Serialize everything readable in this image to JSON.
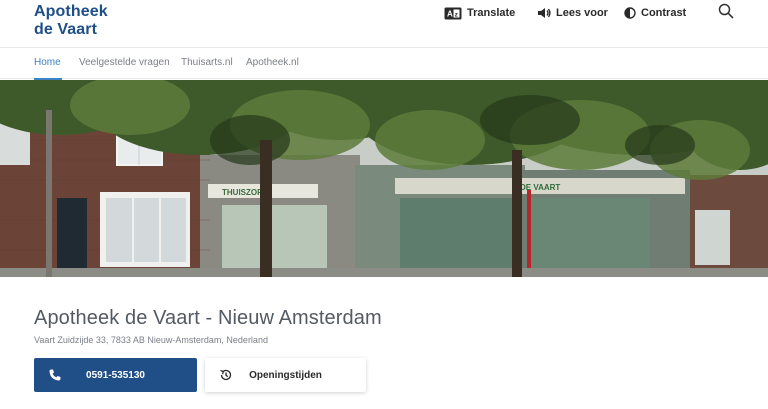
{
  "brand": {
    "line1": "Apotheek",
    "line2": "de Vaart"
  },
  "toolbar": {
    "translate_label": "Translate",
    "translate_icon": "translate-icon",
    "read_label": "Lees voor",
    "read_icon": "speaker-icon",
    "contrast_label": "Contrast",
    "contrast_icon": "contrast-icon",
    "search_icon": "search-icon"
  },
  "nav": {
    "items": [
      {
        "label": "Home",
        "active": true
      },
      {
        "label": "Veelgestelde vragen",
        "active": false
      },
      {
        "label": "Thuisarts.nl",
        "active": false
      },
      {
        "label": "Apotheek.nl",
        "active": false
      }
    ]
  },
  "hero": {
    "description_image": "pharmacy-storefront-photo"
  },
  "pharmacy": {
    "title": "Apotheek de Vaart - Nieuw Amsterdam",
    "address": "Vaart Zuidzijde 33, 7833 AB Nieuw-Amsterdam, Nederland"
  },
  "actions": {
    "phone_label": "0591-535130",
    "phone_icon": "phone-icon",
    "hours_label": "Openingstijden",
    "hours_icon": "history-icon"
  },
  "colors": {
    "brand": "#1f4f86",
    "accent": "#3b83c4",
    "text": "#545a63"
  }
}
